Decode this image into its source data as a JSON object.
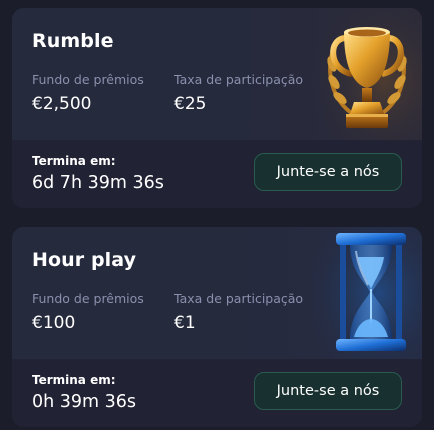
{
  "cards": [
    {
      "title": "Rumble",
      "prize_label": "Fundo de prêmios",
      "prize_value": "€2,500",
      "fee_label": "Taxa de participação",
      "fee_value": "€25",
      "ends_label": "Termina em:",
      "ends_value": "6d 7h 39m 36s",
      "join_label": "Junte-se a nós",
      "icon": "trophy-icon"
    },
    {
      "title": "Hour play",
      "prize_label": "Fundo de prêmios",
      "prize_value": "€100",
      "fee_label": "Taxa de participação",
      "fee_value": "€1",
      "ends_label": "Termina em:",
      "ends_value": "0h 39m 36s",
      "join_label": "Junte-se a nós",
      "icon": "hourglass-icon"
    }
  ],
  "colors": {
    "background": "#1b1d2a",
    "card": "#232638",
    "label": "#8a90ad",
    "button_bg": "#18302f",
    "button_border": "#2a5a50"
  }
}
